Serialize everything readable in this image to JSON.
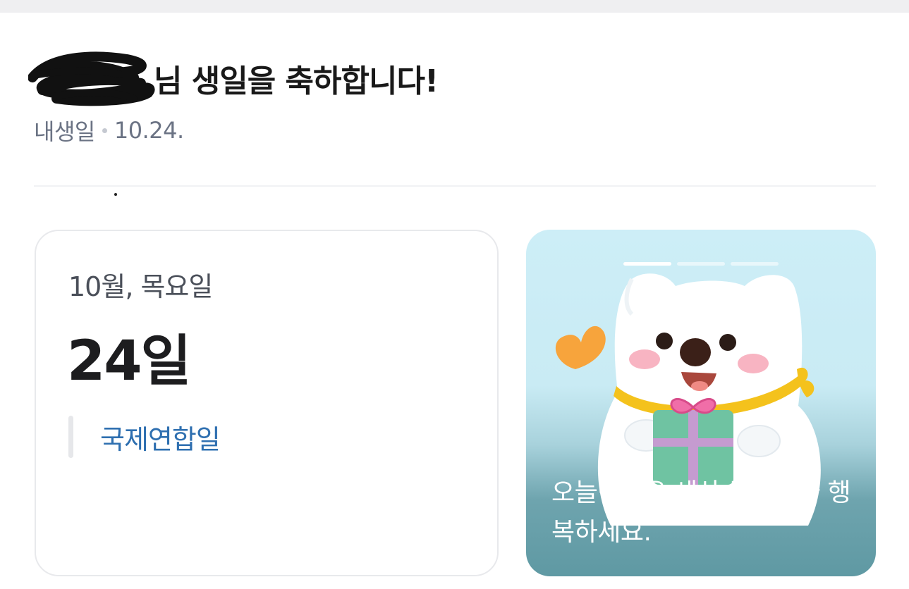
{
  "header": {
    "title": "님 생일을 축하합니다!",
    "meta_label": "내생일",
    "meta_date": "10.24."
  },
  "date_card": {
    "month_weekday": "10월, 목요일",
    "day": "24일",
    "holiday": "국제연합일"
  },
  "story_card": {
    "caption": "오늘만큼은 세상 누구보다 행복하세요.",
    "slides_total": 3,
    "slide_active": 1,
    "colors": {
      "sky": "#cdeef7",
      "bottom": "#5f99a3",
      "heart": "#f7a43c",
      "scarf": "#f4c21c",
      "gift": "#6fc3a2",
      "ribbon": "#f06ea8"
    }
  },
  "colors": {
    "title": "#191919",
    "meta": "#6b7384",
    "holiday": "#2e6fb0"
  }
}
